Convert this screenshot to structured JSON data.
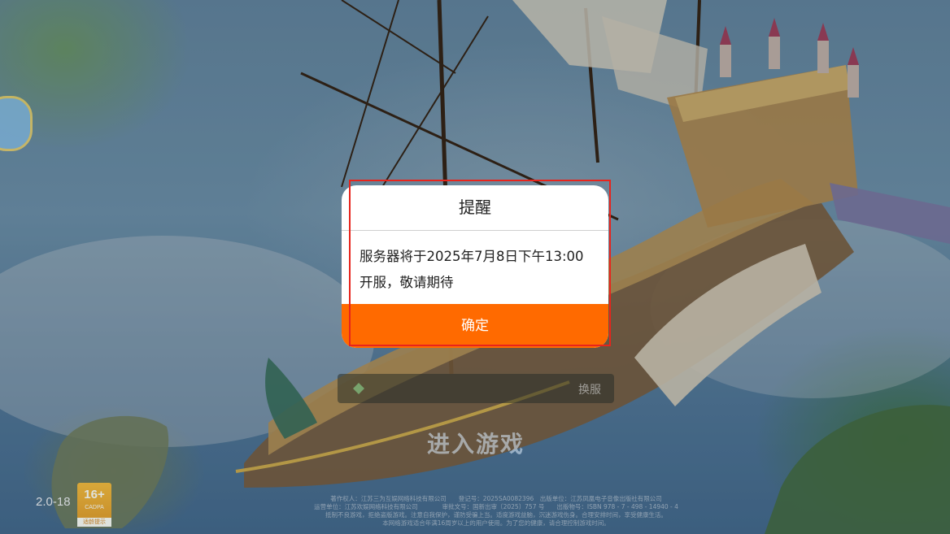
{
  "dialog": {
    "title": "提醒",
    "message_line1": "服务器将于2025年7月8日下午13:00",
    "message_line2": "开服，敬请期待",
    "confirm_label": "确定"
  },
  "server_bar": {
    "switch_label": "换服"
  },
  "enter_game_label": "进入游戏",
  "version": "2.0-18",
  "age_rating": {
    "age": "16+",
    "org": "CADPA",
    "tip": "适龄提示"
  },
  "legal": {
    "line1": "著作权人：江苏三为互娱网络科技有限公司　　登记号：2025SA0082396　出版单位：江苏凤凰电子音像出版社有限公司",
    "line2": "运营单位：江苏欢娱网络科技有限公司　　　　审批文号：国新出审〔2025〕757 号　　出版物号：ISBN 978 - 7 - 498 - 14940 - 4",
    "line3": "抵制不良游戏，拒绝盗版游戏。注意自我保护，谨防受骗上当。适度游戏益脑，沉迷游戏伤身。合理安排时间，享受健康生活。",
    "line4": "本网络游戏适合年满16周岁以上的用户使用。为了您的健康，请合理控制游戏时间。"
  },
  "colors": {
    "accent": "#ff6a00",
    "highlight_border": "#e8241c"
  }
}
